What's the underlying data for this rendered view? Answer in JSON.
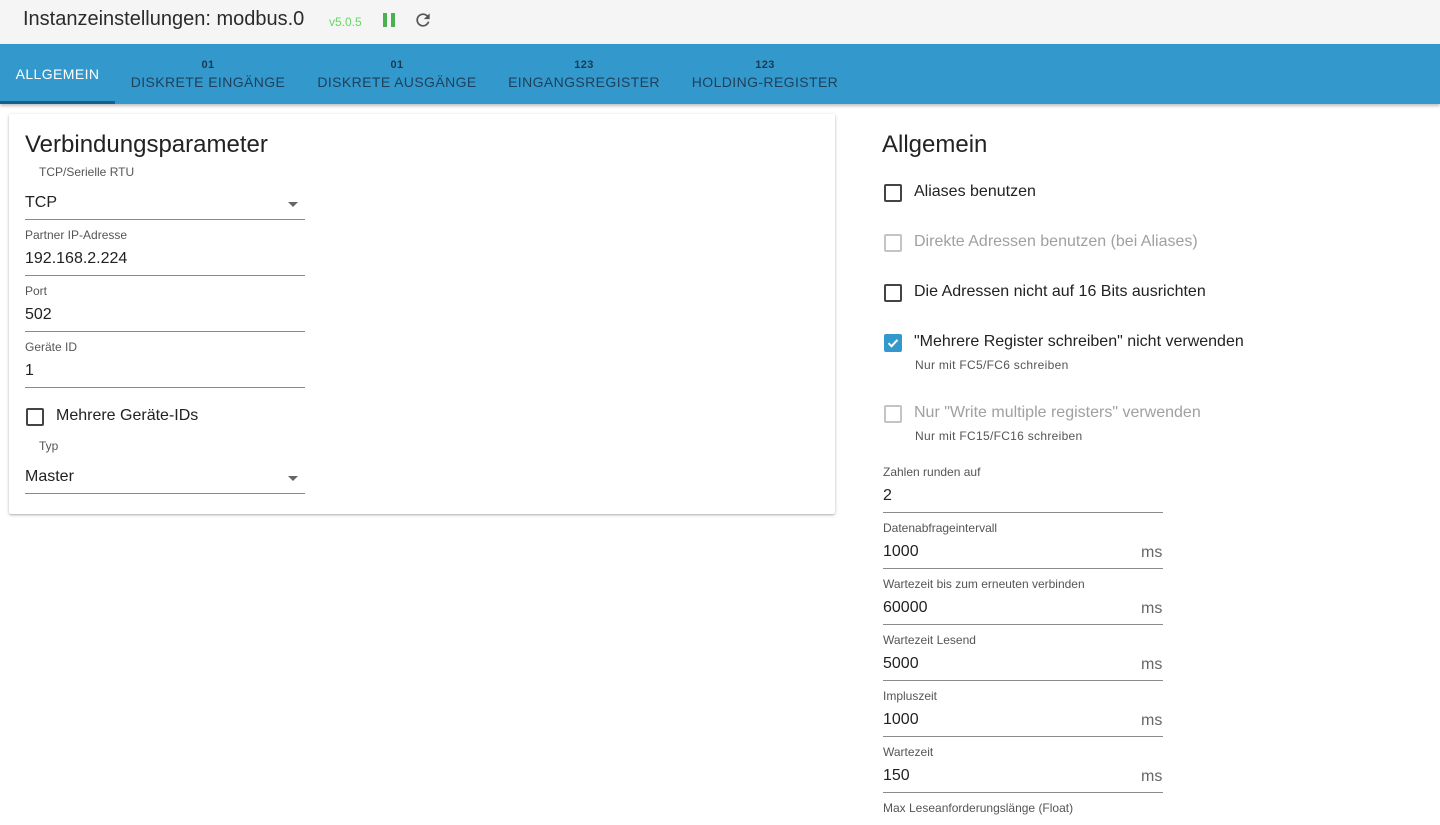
{
  "header": {
    "title": "Instanzeinstellungen: modbus.0",
    "version": "v5.0.5",
    "pause_icon": "pause-icon",
    "reload_icon": "reload-icon",
    "accent_green": "#4caf50"
  },
  "tabs": [
    {
      "label": "ALLGEMEIN",
      "sub": "",
      "active": true
    },
    {
      "label": "DISKRETE EINGÄNGE",
      "sub": "01",
      "active": false
    },
    {
      "label": "DISKRETE AUSGÄNGE",
      "sub": "01",
      "active": false
    },
    {
      "label": "EINGANGSREGISTER",
      "sub": "123",
      "active": false
    },
    {
      "label": "HOLDING-REGISTER",
      "sub": "123",
      "active": false
    }
  ],
  "colors": {
    "tabbar": "#3399cc",
    "checkbox_checked": "#3399cc"
  },
  "connection": {
    "title": "Verbindungsparameter",
    "type_label": "TCP/Serielle RTU",
    "type_value": "TCP",
    "ip_label": "Partner IP-Adresse",
    "ip_value": "192.168.2.224",
    "port_label": "Port",
    "port_value": "502",
    "device_label": "Geräte ID",
    "device_value": "1",
    "multi_device_label": "Mehrere Geräte-IDs",
    "multi_device_checked": false,
    "typ_label": "Typ",
    "typ_value": "Master"
  },
  "general": {
    "title": "Allgemein",
    "aliases_label": "Aliases benutzen",
    "aliases_checked": false,
    "direct_label": "Direkte Adressen benutzen (bei Aliases)",
    "direct_disabled": true,
    "align_label": "Die Adressen nicht auf 16 Bits ausrichten",
    "align_checked": false,
    "no_multi_label": "\"Mehrere Register schreiben\" nicht verwenden",
    "no_multi_checked": true,
    "no_multi_helper": "Nur mit FC5/FC6 schreiben",
    "only_multi_label": "Nur \"Write multiple registers\" verwenden",
    "only_multi_disabled": true,
    "only_multi_helper": "Nur mit FC15/FC16 schreiben",
    "round_label": "Zahlen runden auf",
    "round_value": "2",
    "poll_label": "Datenabfrageintervall",
    "poll_value": "1000",
    "reconnect_label": "Wartezeit bis zum erneuten verbinden",
    "reconnect_value": "60000",
    "read_wait_label": "Wartezeit Lesend",
    "read_wait_value": "5000",
    "pulse_label": "Impluszeit",
    "pulse_value": "1000",
    "wait_label": "Wartezeit",
    "wait_value": "150",
    "max_read_label": "Max Leseanforderungslänge (Float)",
    "unit_ms": "ms"
  }
}
